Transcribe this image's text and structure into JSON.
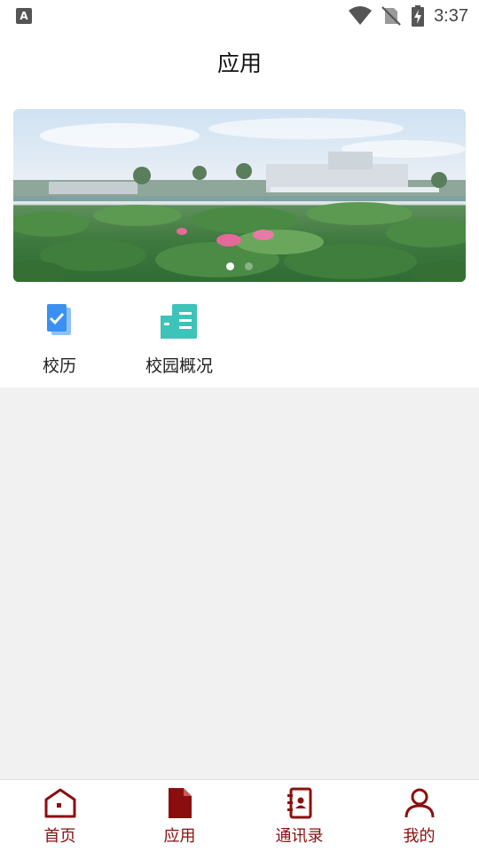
{
  "status_bar": {
    "time": "3:37",
    "left_icon": "A"
  },
  "header": {
    "title": "应用"
  },
  "banner": {
    "active_slide": 1,
    "slide_count": 2
  },
  "apps": [
    {
      "label": "校历",
      "icon": "calendar-check-icon",
      "color": "#3b8ff0"
    },
    {
      "label": "校园概况",
      "icon": "building-icon",
      "color": "#3ec3b8"
    }
  ],
  "bottom_nav": {
    "active_color": "#8b0e0e",
    "items": [
      {
        "label": "首页",
        "icon": "home-icon"
      },
      {
        "label": "应用",
        "icon": "document-icon"
      },
      {
        "label": "通讯录",
        "icon": "contacts-book-icon"
      },
      {
        "label": "我的",
        "icon": "person-icon"
      }
    ]
  }
}
